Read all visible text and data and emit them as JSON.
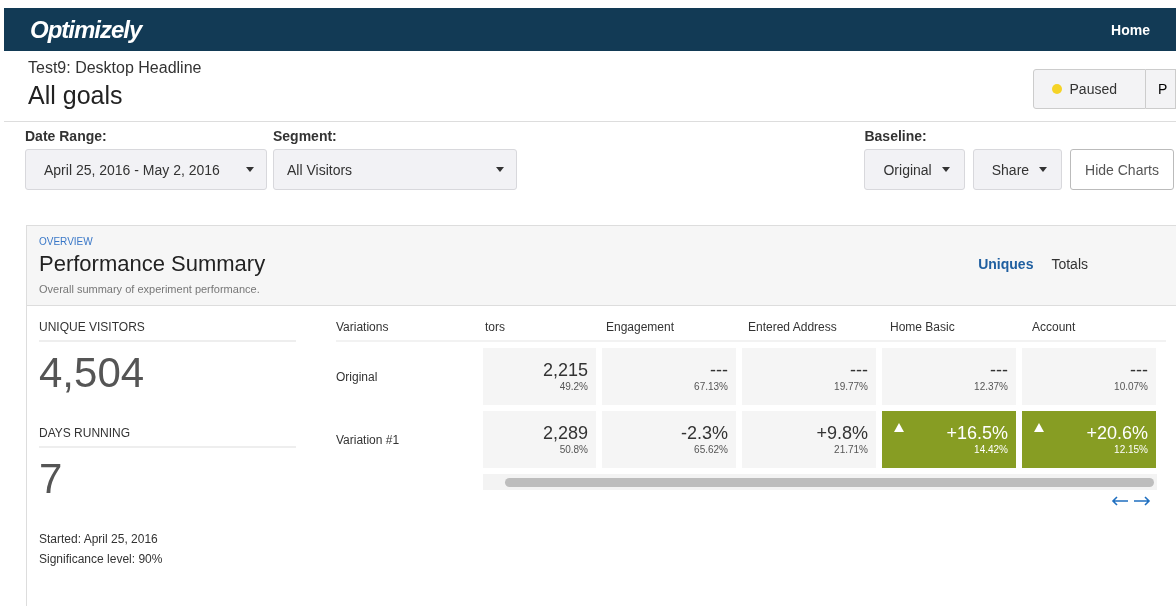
{
  "navbar": {
    "logo": "Optimizely",
    "links": [
      "Home"
    ]
  },
  "header": {
    "subtitle": "Test9: Desktop Headline",
    "title": "All goals",
    "status": {
      "label": "Paused",
      "color": "#f5d327"
    },
    "next_tab": "P"
  },
  "filters": {
    "date_range": {
      "label": "Date Range:",
      "value": "April 25, 2016 - May 2, 2016"
    },
    "segment": {
      "label": "Segment:",
      "value": "All Visitors"
    },
    "baseline": {
      "label": "Baseline:",
      "value": "Original"
    },
    "share_button": "Share",
    "hide_charts_button": "Hide Charts"
  },
  "summary": {
    "eyebrow": "OVERVIEW",
    "title": "Performance Summary",
    "description": "Overall summary of experiment performance.",
    "view_toggle": [
      {
        "label": "Uniques",
        "selected": true
      },
      {
        "label": "Totals",
        "selected": false
      }
    ],
    "stats": [
      {
        "label": "UNIQUE VISITORS",
        "value": "4,504"
      },
      {
        "label": "DAYS RUNNING",
        "value": "7"
      }
    ],
    "started": "Started: April 25, 2016",
    "significance": "Significance level: 90%",
    "table": {
      "columns": [
        "Variations",
        "tors",
        "Engagement",
        "Entered Address",
        "Home Basic",
        "Account"
      ],
      "rows": [
        {
          "name": "Original",
          "cells": [
            {
              "value": "2,215",
              "sub": "49.2%",
              "significant": false
            },
            {
              "value": "---",
              "sub": "67.13%",
              "significant": false
            },
            {
              "value": "---",
              "sub": "19.77%",
              "significant": false
            },
            {
              "value": "---",
              "sub": "12.37%",
              "significant": false
            },
            {
              "value": "---",
              "sub": "10.07%",
              "significant": false
            }
          ]
        },
        {
          "name": "Variation #1",
          "cells": [
            {
              "value": "2,289",
              "sub": "50.8%",
              "significant": false
            },
            {
              "value": "-2.3%",
              "sub": "65.62%",
              "significant": false
            },
            {
              "value": "+9.8%",
              "sub": "21.71%",
              "significant": false
            },
            {
              "value": "+16.5%",
              "sub": "14.42%",
              "significant": true
            },
            {
              "value": "+20.6%",
              "sub": "12.15%",
              "significant": true
            }
          ]
        }
      ]
    }
  }
}
